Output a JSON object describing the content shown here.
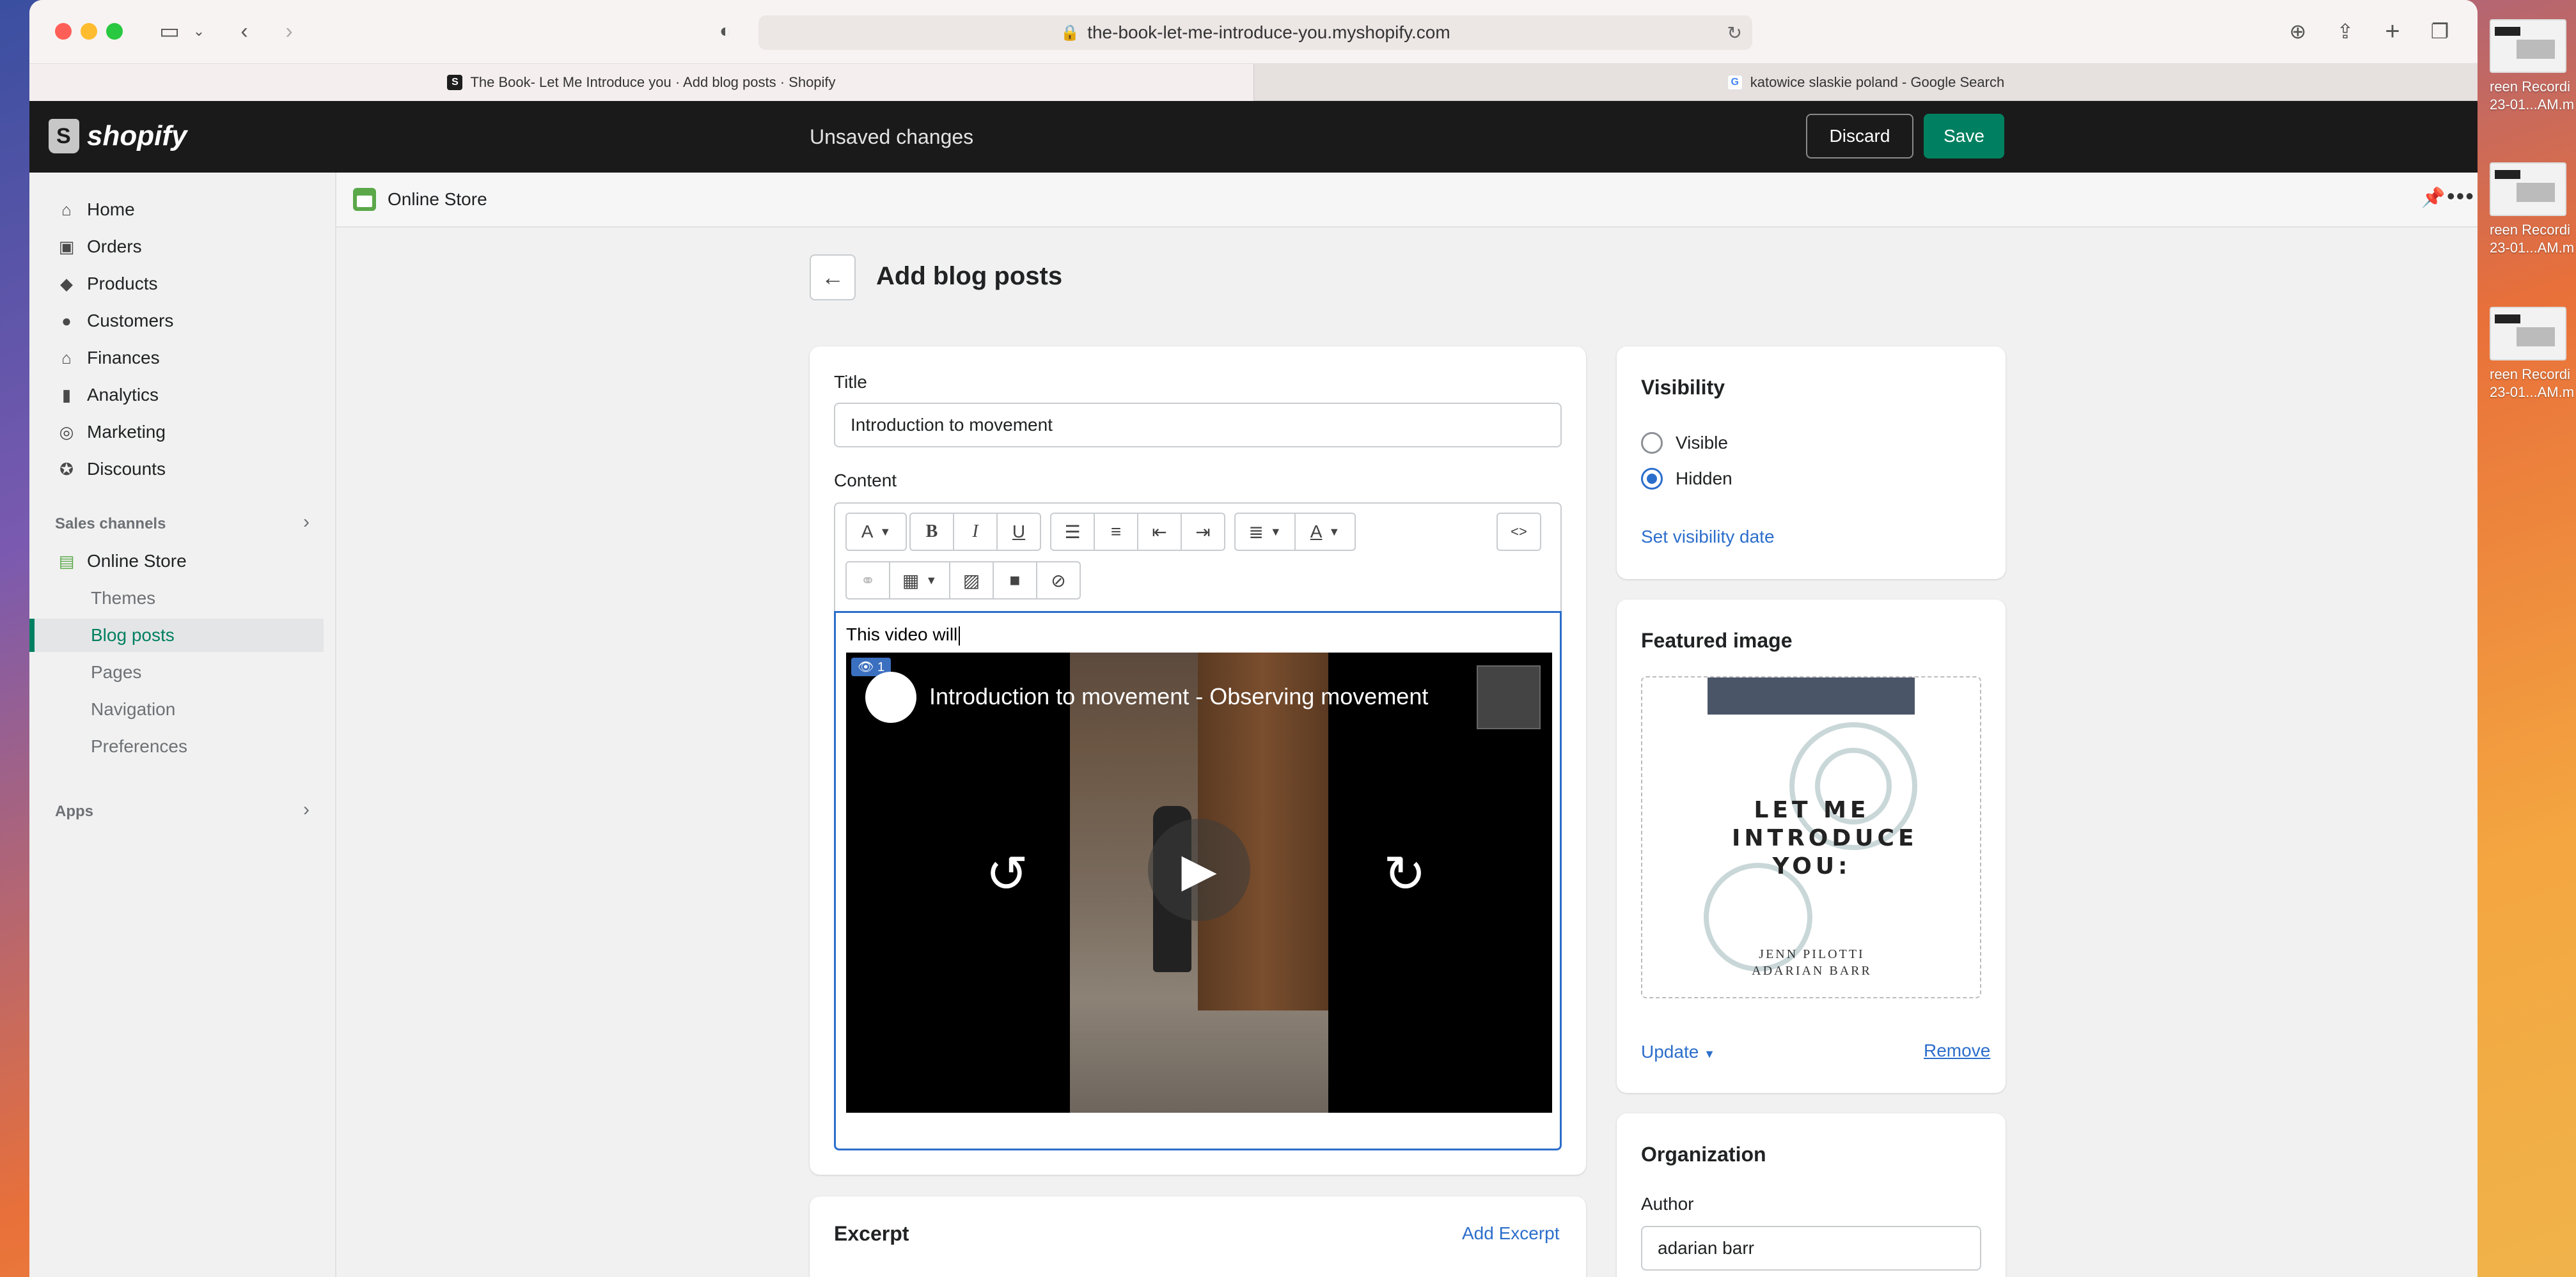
{
  "browser": {
    "url": "the-book-let-me-introduce-you.myshopify.com",
    "tabs": [
      {
        "label": "The Book- Let Me Introduce you · Add blog posts · Shopify"
      },
      {
        "label": "katowice slaskie poland - Google Search"
      }
    ]
  },
  "topbar": {
    "brand": "shopify",
    "status": "Unsaved changes",
    "discard_label": "Discard",
    "save_label": "Save"
  },
  "sidebar": {
    "items": [
      {
        "label": "Home",
        "icon": "home-icon"
      },
      {
        "label": "Orders",
        "icon": "orders-icon"
      },
      {
        "label": "Products",
        "icon": "tag-icon"
      },
      {
        "label": "Customers",
        "icon": "person-icon"
      },
      {
        "label": "Finances",
        "icon": "bank-icon"
      },
      {
        "label": "Analytics",
        "icon": "bar-chart-icon"
      },
      {
        "label": "Marketing",
        "icon": "target-icon"
      },
      {
        "label": "Discounts",
        "icon": "discount-icon"
      }
    ],
    "sales_channels_label": "Sales channels",
    "online_store_label": "Online Store",
    "sub_items": [
      {
        "label": "Themes"
      },
      {
        "label": "Blog posts"
      },
      {
        "label": "Pages"
      },
      {
        "label": "Navigation"
      },
      {
        "label": "Preferences"
      }
    ],
    "apps_label": "Apps"
  },
  "breadcrumb": {
    "store": "Online Store"
  },
  "page": {
    "title": "Add blog posts"
  },
  "form": {
    "title_label": "Title",
    "title_value": "Introduction to movement",
    "content_label": "Content",
    "content_text": "This video will",
    "video": {
      "title": "Introduction to movement - Observing movement",
      "views_badge": "👁 1"
    },
    "excerpt_title": "Excerpt",
    "add_excerpt_label": "Add Excerpt"
  },
  "visibility": {
    "title": "Visibility",
    "options": [
      {
        "label": "Visible",
        "selected": false
      },
      {
        "label": "Hidden",
        "selected": true
      }
    ],
    "set_date_label": "Set visibility date"
  },
  "featured_image": {
    "title": "Featured image",
    "cover_title": "LET ME INTRODUCE YOU:",
    "cover_authors": "JENN PILOTTI ADARIAN BARR",
    "update_label": "Update",
    "remove_label": "Remove"
  },
  "organization": {
    "title": "Organization",
    "author_label": "Author",
    "author_value": "adarian barr"
  },
  "desktop": {
    "items": [
      {
        "label": "reen Recordi",
        "label2": "23-01...AM.m"
      },
      {
        "label": "reen Recordi",
        "label2": "23-01...AM.m"
      },
      {
        "label": "reen Recordi",
        "label2": "23-01...AM.m"
      }
    ]
  },
  "colors": {
    "accent": "#008060",
    "link": "#2c6ecb",
    "topbar": "#1a1a1a"
  }
}
